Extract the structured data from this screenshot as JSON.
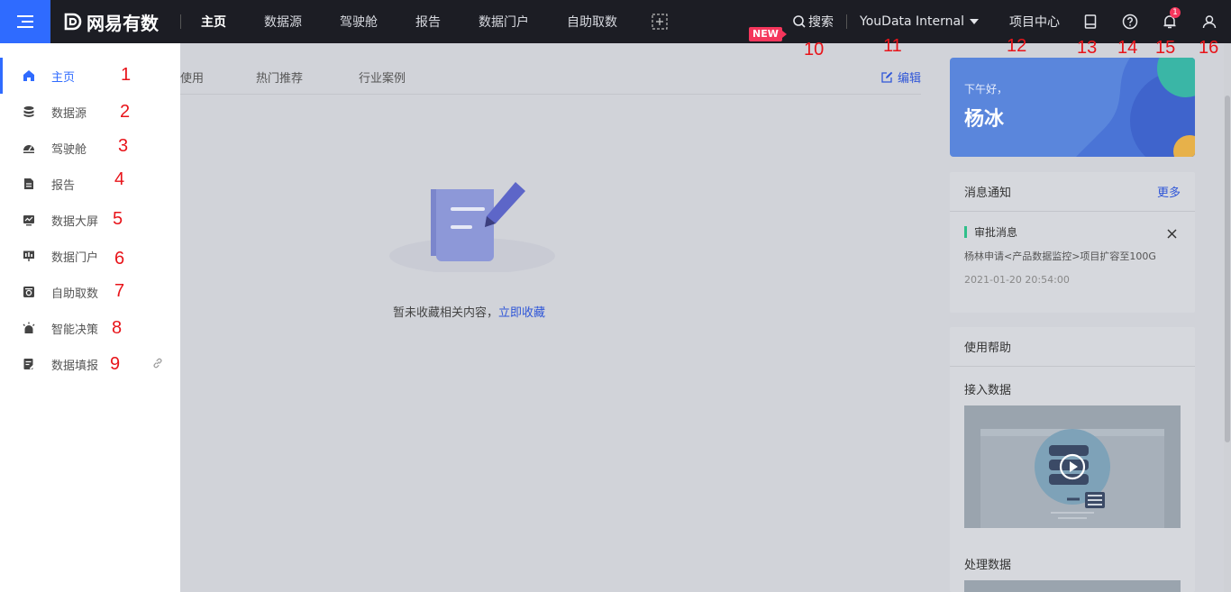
{
  "brand": {
    "name": "网易有数",
    "accent": "#2f6bff"
  },
  "topnav": {
    "items": [
      {
        "label": "主页",
        "active": true
      },
      {
        "label": "数据源"
      },
      {
        "label": "驾驶舱"
      },
      {
        "label": "报告"
      },
      {
        "label": "数据门户"
      },
      {
        "label": "自助取数"
      }
    ],
    "add_icon": "plus-square-icon"
  },
  "tools": {
    "new_badge": "NEW",
    "search_label": "搜索",
    "workspace": "YouData Internal",
    "project_center": "项目中心",
    "icons": [
      "book-icon",
      "help-icon",
      "bell-icon",
      "user-icon"
    ],
    "bell_count": "1"
  },
  "sidebar": {
    "items": [
      {
        "label": "主页",
        "icon": "home-icon",
        "active": true
      },
      {
        "label": "数据源",
        "icon": "database-icon"
      },
      {
        "label": "驾驶舱",
        "icon": "dashboard-icon"
      },
      {
        "label": "报告",
        "icon": "report-icon"
      },
      {
        "label": "数据大屏",
        "icon": "screen-icon"
      },
      {
        "label": "数据门户",
        "icon": "portal-icon"
      },
      {
        "label": "自助取数",
        "icon": "fetch-icon"
      },
      {
        "label": "智能决策",
        "icon": "decision-icon"
      },
      {
        "label": "数据填报",
        "icon": "form-icon",
        "link_icon": "link-icon"
      }
    ]
  },
  "annotations": [
    "1",
    "2",
    "3",
    "4",
    "5",
    "6",
    "7",
    "8",
    "9",
    "10",
    "11",
    "12",
    "13",
    "14",
    "15",
    "16"
  ],
  "main": {
    "tabs": [
      "使用",
      "热门推荐",
      "行业案例"
    ],
    "edit_label": "编辑",
    "empty_text": "暂未收藏相关内容，",
    "empty_link": "立即收藏"
  },
  "greeting": {
    "small": "下午好，",
    "name": "杨冰"
  },
  "messages": {
    "title": "消息通知",
    "more": "更多",
    "item": {
      "type": "审批消息",
      "body": "杨林申请<产品数据监控>项目扩容至100G",
      "time": "2021-01-20 20:54:00"
    }
  },
  "help": {
    "title": "使用帮助",
    "sections": [
      "接入数据",
      "处理数据"
    ]
  }
}
